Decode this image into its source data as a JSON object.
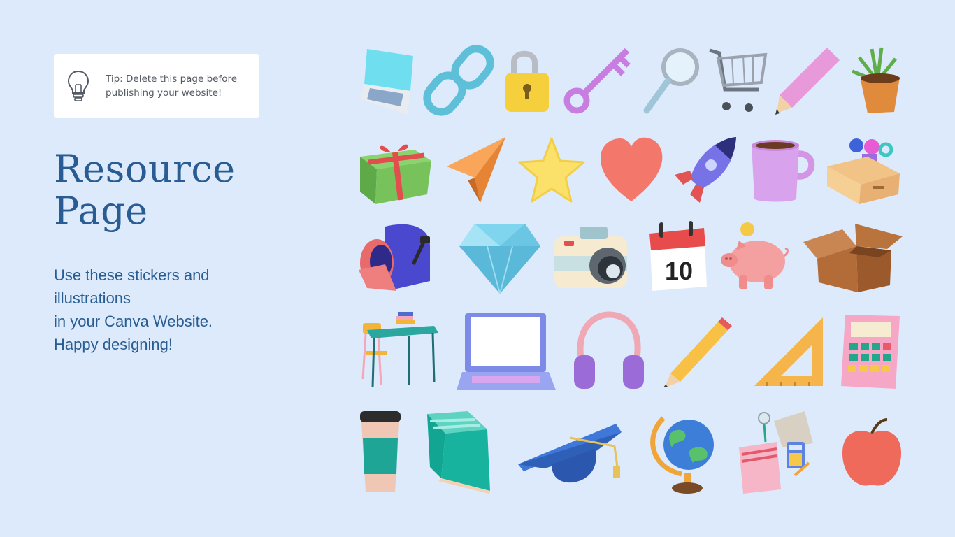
{
  "tip": {
    "icon": "lightbulb-icon",
    "line1": "Tip: Delete this page before",
    "line2": "publishing your website!"
  },
  "title": {
    "line1": "Resource",
    "line2": "Page"
  },
  "description": {
    "line1": "Use these stickers and",
    "line2": "illustrations",
    "line3": "in your Canva Website.",
    "line4": "Happy designing!"
  },
  "stickers": {
    "row1": [
      "laptop-icon",
      "chain-link-icon",
      "padlock-icon",
      "key-icon",
      "magnifying-glass-icon",
      "shopping-cart-icon",
      "pencil-icon",
      "potted-plant-icon"
    ],
    "row2": [
      "gift-box-icon",
      "paper-plane-icon",
      "star-icon",
      "heart-icon",
      "rocket-icon",
      "mug-icon",
      "open-box-with-shapes-icon"
    ],
    "row3": [
      "mailbox-icon",
      "diamond-icon",
      "camera-icon",
      "calendar-icon",
      "piggy-bank-icon",
      "cardboard-box-icon"
    ],
    "row4": [
      "school-desk-icon",
      "laptop-open-icon",
      "headphones-icon",
      "pencil-icon",
      "set-square-ruler-icon",
      "calculator-icon"
    ],
    "row5": [
      "coffee-cup-icon",
      "book-icon",
      "graduation-cap-icon",
      "globe-icon",
      "stationery-set-icon",
      "apple-icon"
    ]
  },
  "calendar": {
    "day": "10"
  },
  "colors": {
    "background": "#ddeafb",
    "title": "#285c92",
    "tip_text": "#555a63",
    "card": "#ffffff"
  }
}
